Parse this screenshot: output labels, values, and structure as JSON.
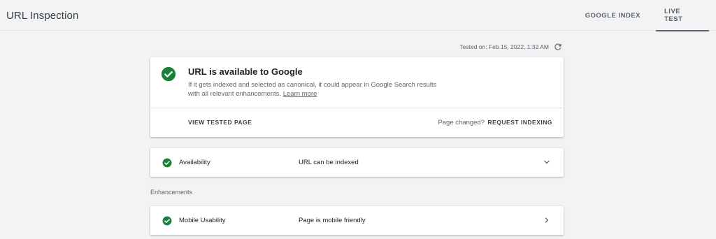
{
  "header": {
    "title": "URL Inspection",
    "tabs": [
      {
        "label": "GOOGLE INDEX",
        "active": false
      },
      {
        "label": "LIVE TEST",
        "active": true
      }
    ]
  },
  "tested": {
    "text": "Tested on: Feb 15, 2022, 1:32 AM",
    "icon": "refresh-icon"
  },
  "main": {
    "status_icon": "check-circle-icon",
    "title": "URL is available to Google",
    "description": "If it gets indexed and selected as canonical, it could appear in Google Search results with all relevant enhancements.",
    "learn_more": "Learn more",
    "view_tested_page": "VIEW TESTED PAGE",
    "page_changed": "Page changed?",
    "request_indexing": "REQUEST INDEXING"
  },
  "availability": {
    "label": "Availability",
    "value": "URL can be indexed",
    "icon": "chevron-down-icon"
  },
  "enhancements": {
    "section_label": "Enhancements",
    "items": [
      {
        "label": "Mobile Usability",
        "value": "Page is mobile friendly",
        "icon": "chevron-right-icon"
      }
    ]
  },
  "colors": {
    "success_green": "#188038",
    "text_secondary": "#5f6368",
    "background": "#f1f3f4"
  }
}
